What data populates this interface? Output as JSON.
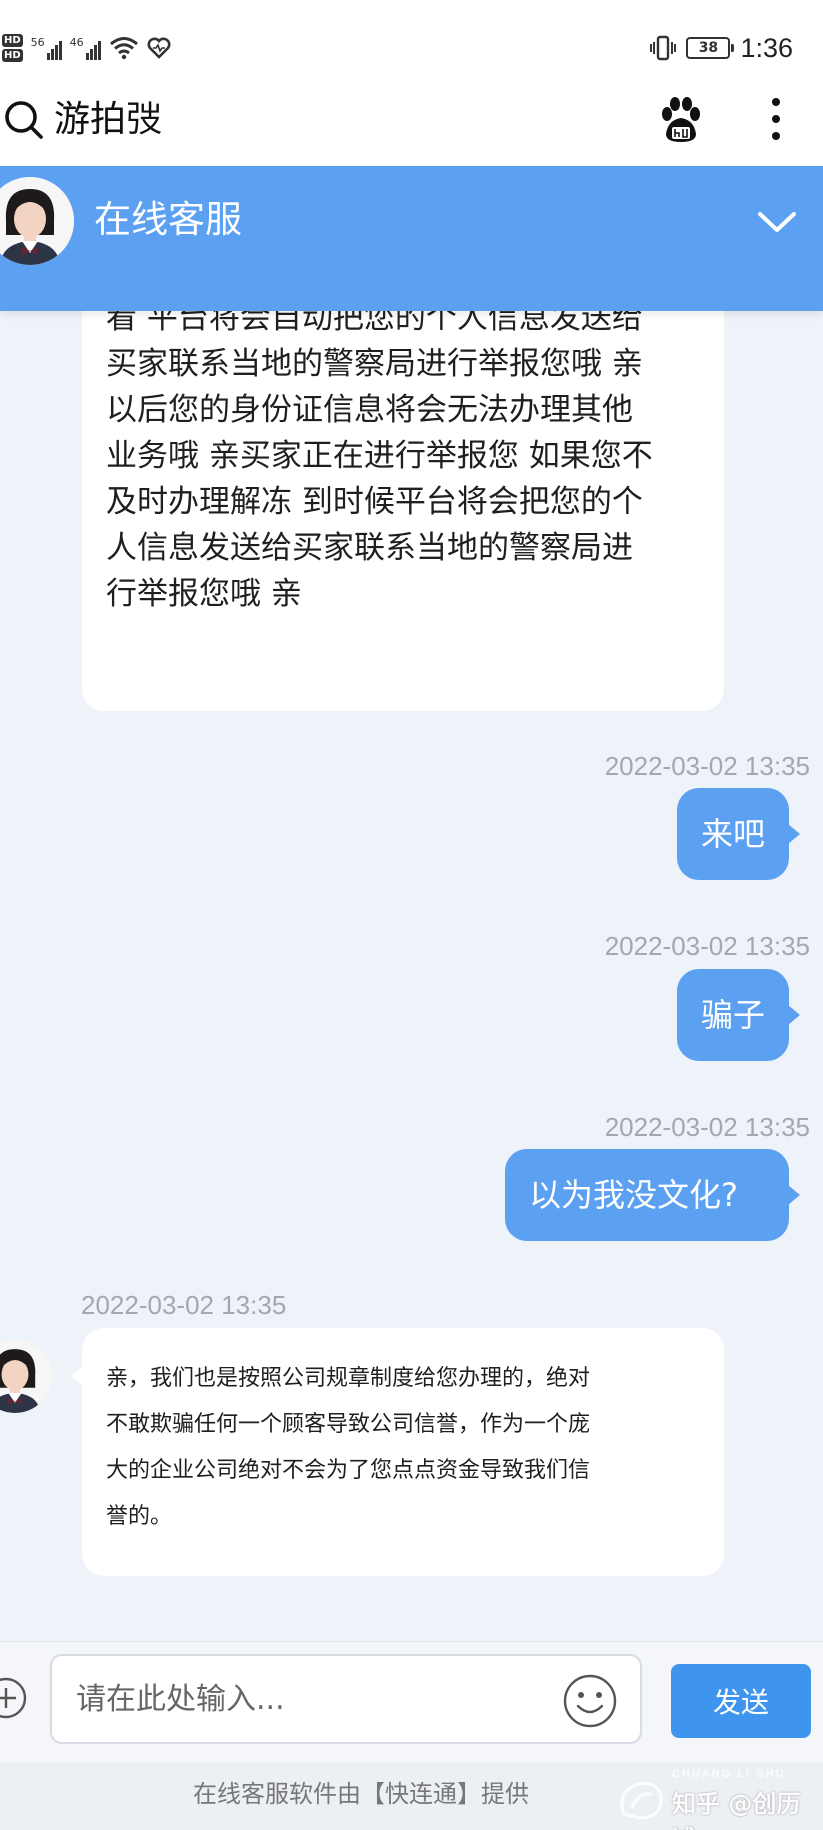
{
  "status_bar": {
    "network_left": "56",
    "network_right": "46",
    "hd_label": "HD",
    "battery": "38",
    "time": "1:36"
  },
  "browser": {
    "query": "游拍弢",
    "icons": [
      "search-icon",
      "baidu-paw-icon",
      "more-vertical-icon"
    ]
  },
  "header": {
    "title": "在线客服",
    "icons": [
      "agent-avatar",
      "chevron-down-icon"
    ]
  },
  "messages": {
    "agent_top": {
      "lines": [
        "看 平台将会自动把您的个人信息发送给",
        "买家联系当地的警察局进行举报您哦 亲",
        "以后您的身份证信息将会无法办理其他",
        "业务哦 亲买家正在进行举报您 如果您不",
        "及时办理解冻 到时候平台将会把您的个",
        "人信息发送给买家联系当地的警察局进",
        "行举报您哦 亲"
      ]
    },
    "user_1": {
      "time": "2022-03-02 13:35",
      "text": "来吧"
    },
    "user_2": {
      "time": "2022-03-02 13:35",
      "text": "骗子"
    },
    "user_3": {
      "time": "2022-03-02 13:35",
      "text": "以为我没文化?"
    },
    "agent_bottom": {
      "time": "2022-03-02 13:35",
      "lines": [
        "亲，我们也是按照公司规章制度给您办理的，绝对",
        "不敢欺骗任何一个顾客导致公司信誉，作为一个庞",
        "大的企业公司绝对不会为了您点点资金导致我们信",
        "誉的。"
      ]
    }
  },
  "input": {
    "placeholder": "请在此处输入...",
    "send_label": "发送",
    "icons": [
      "plus-icon",
      "emoji-icon"
    ]
  },
  "footer": {
    "text": "在线客服软件由【快连通】提供",
    "watermark_latin": "CHUANG LI SHU",
    "watermark_cn": "知乎 @创历述"
  },
  "colors": {
    "accent": "#5ba0f1",
    "send_button": "#3f95ee",
    "chat_background": "#eef2f9",
    "timestamp": "#a3a8b0"
  }
}
